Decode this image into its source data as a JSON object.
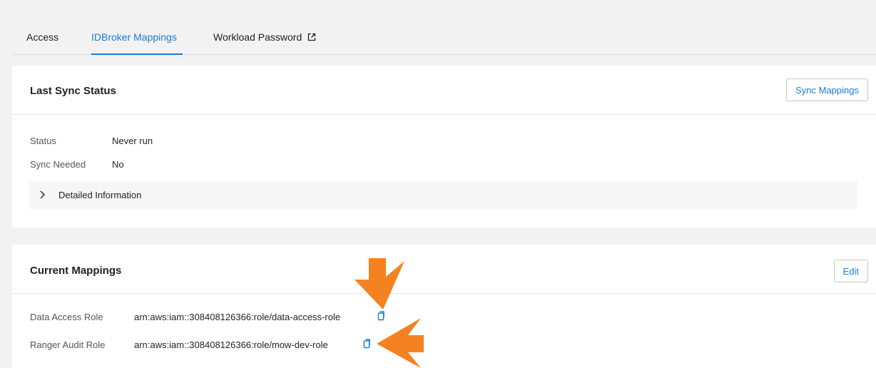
{
  "tabs": {
    "access": "Access",
    "idbroker": "IDBroker Mappings",
    "workload": "Workload Password",
    "active": "idbroker"
  },
  "sync": {
    "title": "Last Sync Status",
    "button": "Sync Mappings",
    "status_label": "Status",
    "status_value": "Never run",
    "needed_label": "Sync Needed",
    "needed_value": "No",
    "details_label": "Detailed Information"
  },
  "mappings": {
    "title": "Current Mappings",
    "edit_button": "Edit",
    "rows": [
      {
        "label": "Data Access Role",
        "value": "arn:aws:iam::308408126366:role/data-access-role"
      },
      {
        "label": "Ranger Audit Role",
        "value": "arn:aws:iam::308408126366:role/mow-dev-role"
      }
    ]
  },
  "icons": {
    "external_link": "external-link-icon",
    "copy": "copy-icon",
    "chevron": "chevron-right-icon",
    "annotation": "arrow-annotation"
  },
  "colors": {
    "accent": "#1a7bd4",
    "annotation_arrow": "#f58220"
  }
}
